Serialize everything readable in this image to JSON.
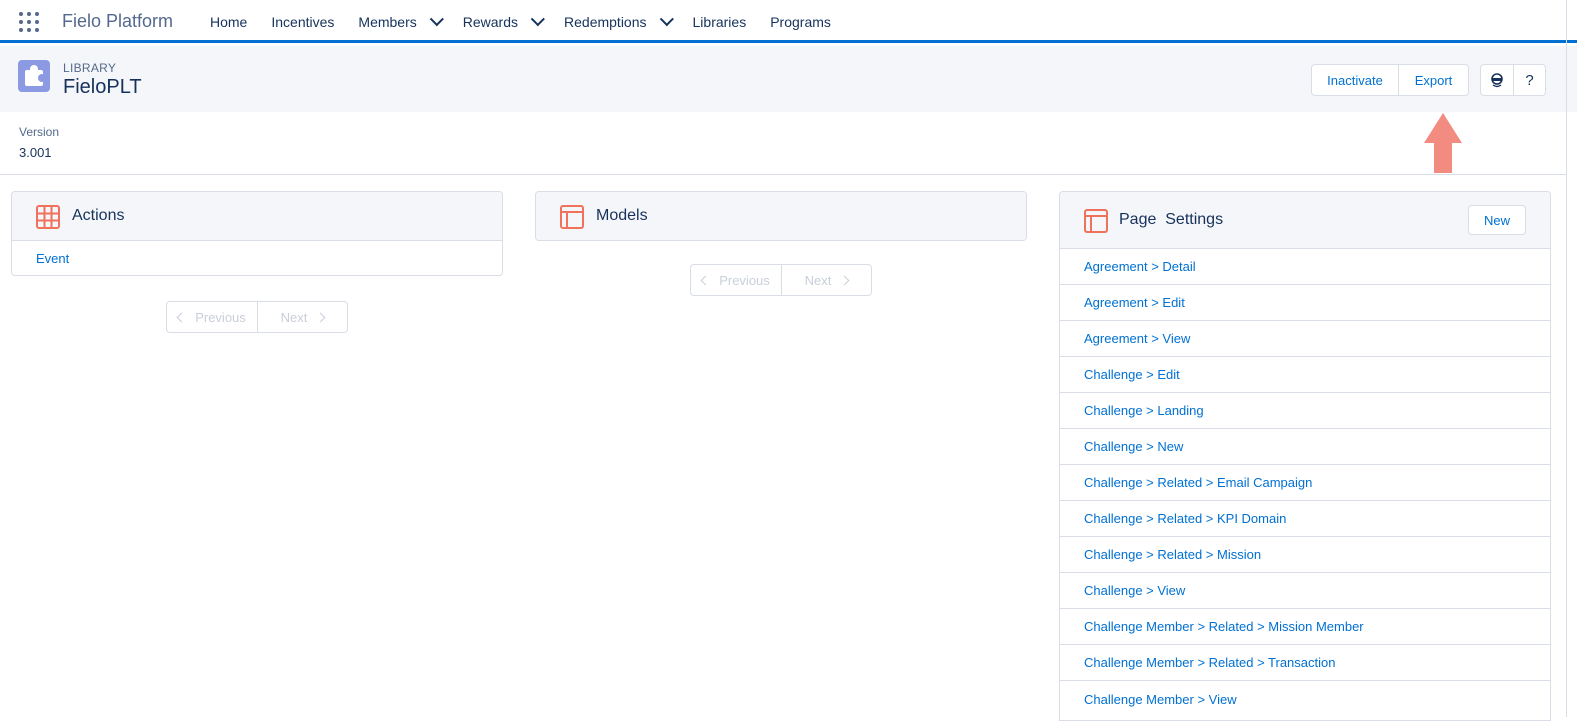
{
  "app": {
    "name": "Fielo Platform"
  },
  "nav": {
    "items": [
      {
        "label": "Home",
        "has_menu": false
      },
      {
        "label": "Incentives",
        "has_menu": false
      },
      {
        "label": "Members",
        "has_menu": true
      },
      {
        "label": "Rewards",
        "has_menu": true
      },
      {
        "label": "Redemptions",
        "has_menu": true
      },
      {
        "label": "Libraries",
        "has_menu": false
      },
      {
        "label": "Programs",
        "has_menu": false
      }
    ]
  },
  "header": {
    "object_type": "LIBRARY",
    "title": "FieloPLT",
    "actions": {
      "inactivate": "Inactivate",
      "export": "Export"
    },
    "icon_buttons": {
      "help": "?"
    }
  },
  "details": {
    "version_label": "Version",
    "version_value": "3.001"
  },
  "cards": {
    "actions": {
      "title": "Actions",
      "rows": [
        "Event"
      ],
      "pager": {
        "previous": "Previous",
        "next": "Next"
      }
    },
    "models": {
      "title": "Models",
      "pager": {
        "previous": "Previous",
        "next": "Next"
      }
    },
    "page_settings": {
      "title": "Page  Settings",
      "new_label": "New",
      "rows": [
        "Agreement > Detail",
        "Agreement > Edit",
        "Agreement > View",
        "Challenge > Edit",
        "Challenge > Landing",
        "Challenge > New",
        "Challenge > Related > Email Campaign",
        "Challenge > Related > KPI Domain",
        "Challenge > Related > Mission",
        "Challenge > View",
        "Challenge Member > Related > Mission Member",
        "Challenge Member > Related > Transaction",
        "Challenge Member > View"
      ]
    }
  },
  "colors": {
    "brand": "#0070d2",
    "icon_accent": "#f0725c",
    "library_icon": "#8b9ae3",
    "annotation_arrow": "#f28b80"
  },
  "icons": {
    "app_launcher": "waffle-icon",
    "library": "puzzle-icon",
    "actions": "grid-icon",
    "models": "layout-icon",
    "page_settings": "layout-icon",
    "avatar": "agent-icon"
  }
}
